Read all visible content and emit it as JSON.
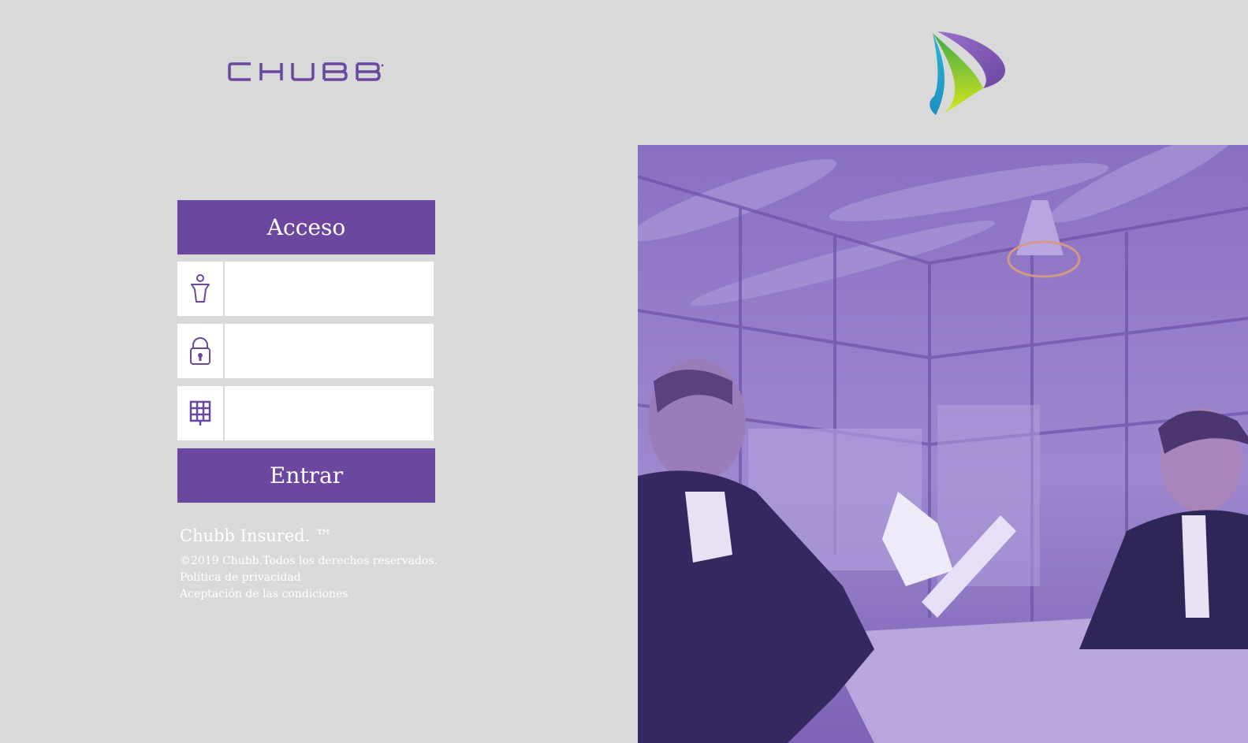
{
  "brand": {
    "logo_text": "CHUBB",
    "logo_color": "#6b479f"
  },
  "login": {
    "title": "Acceso",
    "fields": [
      {
        "icon": "user-icon",
        "value": "",
        "placeholder": ""
      },
      {
        "icon": "lock-icon",
        "value": "",
        "placeholder": ""
      },
      {
        "icon": "keypad-icon",
        "value": "",
        "placeholder": ""
      }
    ],
    "submit_label": "Entrar"
  },
  "footer": {
    "brand_line": "Chubb Insured. ™",
    "copyright": "©2019 Chubb.Todos los derechos reservados.",
    "privacy_link": "Política de privacidad",
    "terms_link": "Aceptación de las condiciones"
  },
  "colors": {
    "accent": "#6b479f",
    "background": "#d9d9d9",
    "overlay": "#7f62b8"
  }
}
